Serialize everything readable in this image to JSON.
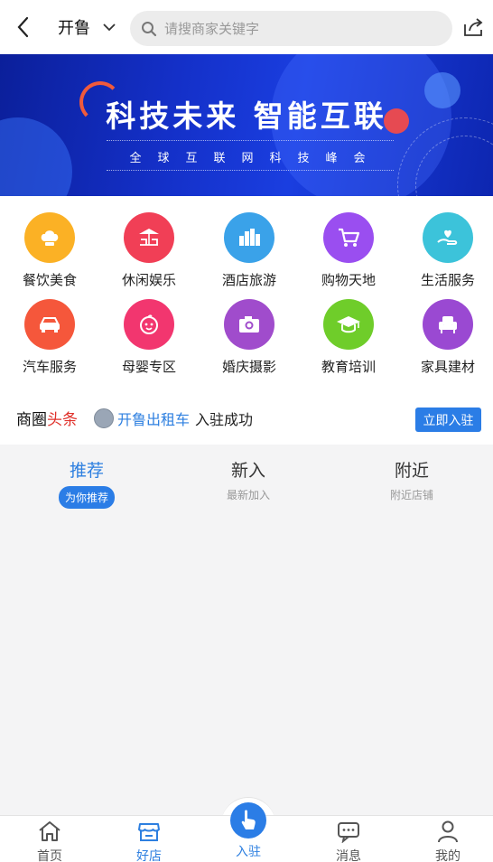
{
  "header": {
    "city": "开鲁",
    "search_placeholder": "请搜商家关键字"
  },
  "banner": {
    "title": "科技未来  智能互联",
    "subtitle": "全球互联网科技峰会"
  },
  "categories": [
    {
      "label": "餐饮美食",
      "icon": "chef-hat-icon",
      "color": "#fbb125"
    },
    {
      "label": "休闲娱乐",
      "icon": "umbrella-lounge-icon",
      "color": "#f13f56"
    },
    {
      "label": "酒店旅游",
      "icon": "city-buildings-icon",
      "color": "#3aa2e9"
    },
    {
      "label": "购物天地",
      "icon": "shopping-cart-icon",
      "color": "#9a4ef0"
    },
    {
      "label": "生活服务",
      "icon": "heart-hand-icon",
      "color": "#3cc3da"
    },
    {
      "label": "汽车服务",
      "icon": "car-icon",
      "color": "#f5573b"
    },
    {
      "label": "母婴专区",
      "icon": "baby-face-icon",
      "color": "#f2366f"
    },
    {
      "label": "婚庆摄影",
      "icon": "camera-icon",
      "color": "#a04ccc"
    },
    {
      "label": "教育培训",
      "icon": "graduation-cap-icon",
      "color": "#6fcd2a"
    },
    {
      "label": "家具建材",
      "icon": "armchair-icon",
      "color": "#9a49d2"
    }
  ],
  "news": {
    "title_prefix": "商圈",
    "title_highlight": "头条",
    "shop_name": "开鲁出租车",
    "message": "入驻成功",
    "join_label": "立即入驻"
  },
  "tabs": [
    {
      "title": "推荐",
      "subtitle": "为你推荐",
      "active": true
    },
    {
      "title": "新入",
      "subtitle": "最新加入",
      "active": false
    },
    {
      "title": "附近",
      "subtitle": "附近店铺",
      "active": false
    }
  ],
  "nav": {
    "home": "首页",
    "shops": "好店",
    "join": "入驻",
    "messages": "消息",
    "mine": "我的"
  },
  "colors": {
    "accent": "#2b7de6",
    "headline_red": "#e0312b"
  }
}
